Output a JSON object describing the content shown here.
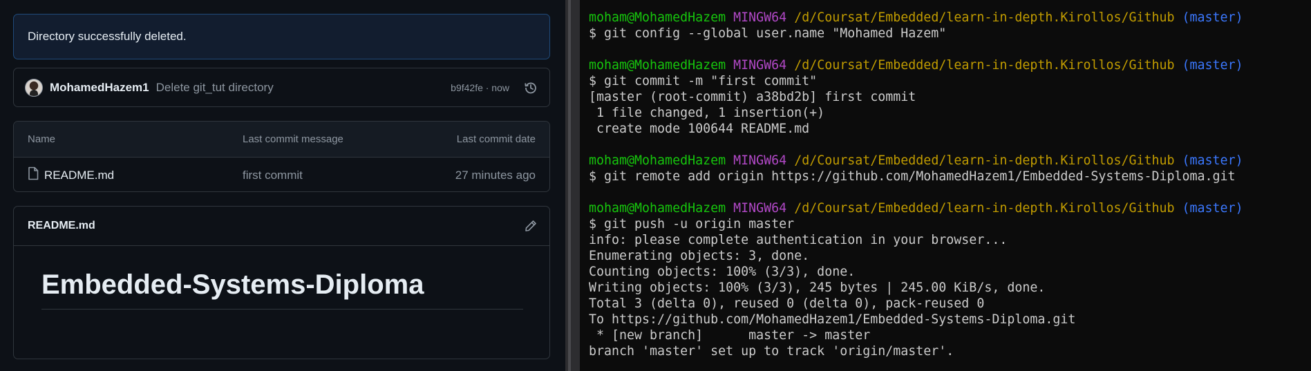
{
  "github": {
    "flash_message": "Directory successfully deleted.",
    "commit": {
      "author": "MohamedHazem1",
      "message": "Delete git_tut directory",
      "meta": "b9f42fe · now"
    },
    "files": {
      "headers": {
        "name": "Name",
        "message": "Last commit message",
        "date": "Last commit date"
      },
      "rows": [
        {
          "name": "README.md",
          "message": "first commit",
          "date": "27 minutes ago",
          "icon": "file-icon"
        }
      ]
    },
    "readme": {
      "header": "README.md",
      "title": "Embedded-Systems-Diploma"
    }
  },
  "terminal": {
    "prompt": {
      "user": "moham@MohamedHazem",
      "system": "MINGW64",
      "path": "/d/Coursat/Embedded/learn-in-depth.Kirollos/Github",
      "branch": "(master)"
    },
    "blocks": [
      {
        "command": "$ git config --global user.name \"Mohamed Hazem\"",
        "output": []
      },
      {
        "command": "$ git commit -m \"first commit\"",
        "output": [
          "[master (root-commit) a38bd2b] first commit",
          " 1 file changed, 1 insertion(+)",
          " create mode 100644 README.md"
        ]
      },
      {
        "command": "$ git remote add origin https://github.com/MohamedHazem1/Embedded-Systems-Diploma.git",
        "output": []
      },
      {
        "command": "$ git push -u origin master",
        "output": [
          "info: please complete authentication in your browser...",
          "Enumerating objects: 3, done.",
          "Counting objects: 100% (3/3), done.",
          "Writing objects: 100% (3/3), 245 bytes | 245.00 KiB/s, done.",
          "Total 3 (delta 0), reused 0 (delta 0), pack-reused 0",
          "To https://github.com/MohamedHazem1/Embedded-Systems-Diploma.git",
          " * [new branch]      master -> master",
          "branch 'master' set up to track 'origin/master'."
        ]
      }
    ]
  },
  "colors": {
    "prompt_user": "#16c60c",
    "prompt_system": "#b148c6",
    "prompt_path": "#c19c00",
    "prompt_branch": "#3b78ff"
  }
}
